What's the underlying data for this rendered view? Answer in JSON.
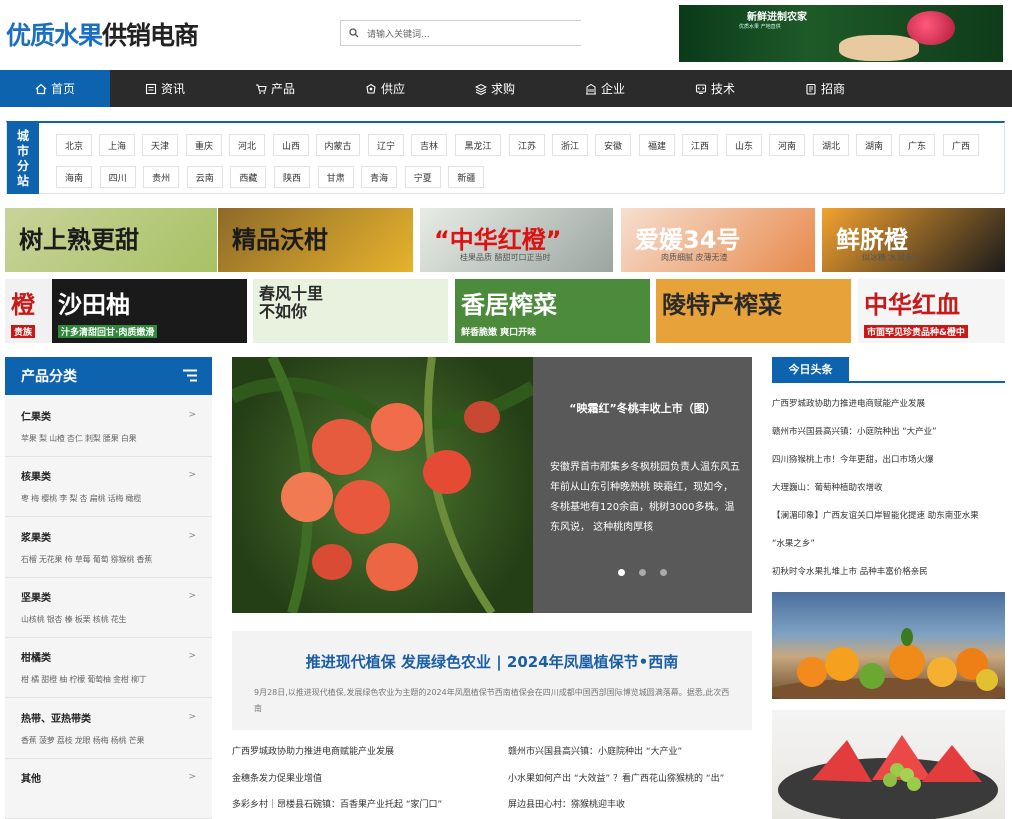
{
  "logo": {
    "part1": "优质水果",
    "part2": "供销电商"
  },
  "search": {
    "placeholder": "请输入关键词..."
  },
  "top_banner": {
    "title": "新鲜进制农家",
    "sub": "优质水果 产地直供"
  },
  "nav": {
    "items": [
      {
        "label": "首页",
        "icon": "home-icon"
      },
      {
        "label": "资讯",
        "icon": "news-icon"
      },
      {
        "label": "产品",
        "icon": "cart-icon"
      },
      {
        "label": "供应",
        "icon": "supply-icon"
      },
      {
        "label": "求购",
        "icon": "buy-icon"
      },
      {
        "label": "企业",
        "icon": "company-icon"
      },
      {
        "label": "技术",
        "icon": "tech-icon"
      },
      {
        "label": "招商",
        "icon": "invest-icon"
      }
    ]
  },
  "city": {
    "label": [
      "城",
      "市",
      "分",
      "站"
    ],
    "row1": [
      "北京",
      "上海",
      "天津",
      "重庆",
      "河北",
      "山西",
      "内蒙古",
      "辽宁",
      "吉林",
      "黑龙江",
      "江苏",
      "浙江",
      "安徽",
      "福建",
      "江西",
      "山东",
      "河南",
      "湖北",
      "湖南",
      "广东",
      "广西"
    ],
    "row2": [
      "海南",
      "四川",
      "贵州",
      "云南",
      "西藏",
      "陕西",
      "甘肃",
      "青海",
      "宁夏",
      "新疆"
    ]
  },
  "ads": {
    "row1": [
      "树上熟更甜",
      "精品沃柑",
      "“中华红橙”",
      "爱媛34号",
      "鲜脐橙"
    ],
    "row1_sub": [
      "",
      "",
      "桂果品质 醋甜可口正当时",
      "肉质细腻 皮薄无渣",
      "似冰糖 水润多汁"
    ],
    "row2": [
      "橙",
      "沙田柚",
      "春风十里\n不如你",
      "香居榨菜",
      "陵特产榨菜",
      "中华红血"
    ],
    "row2_sub": [
      "贵族",
      "汁多清甜回甘·肉质嫩滑",
      "",
      "鲜香脆嫩 爽口开味",
      "",
      "市面罕见珍贵品种&橙中"
    ]
  },
  "sidebar": {
    "title": "产品分类",
    "categories": [
      {
        "name": "仁果类",
        "items": "苹果 梨 山楂 杏仁 刺梨 腰果 白果"
      },
      {
        "name": "核果类",
        "items": "枣 梅 樱桃 李 梨 杏 扁桃 话梅 橄榄"
      },
      {
        "name": "浆果类",
        "items": "石榴 无花果 柿 草莓 葡萄 猕猴桃 香蕉"
      },
      {
        "name": "坚果类",
        "items": "山核桃 银杏 榛 板栗 核桃 花生"
      },
      {
        "name": "柑橘类",
        "items": "柑 橘 甜橙 柚 柠檬 葡萄柚 金柑 柳丁"
      },
      {
        "name": "热带、亚热带类",
        "items": "香蕉 菠萝 荔枝 龙眼 杨梅 杨桃 芒果"
      },
      {
        "name": "其他",
        "items": ""
      }
    ],
    "arrow": ">"
  },
  "slider": {
    "title": "“映霜红”冬桃丰收上市（图）",
    "desc": "安徽界首市邴集乡冬枫桃园负责人温东风五年前从山东引种晚熟桃 映霜红，现如今，冬桃基地有120余亩，桃树3000多株。温东风说， 这种桃肉厚核"
  },
  "feature": {
    "title": "推进现代植保 发展绿色农业 | 2024年凤凰植保节•西南",
    "desc": "9月28日,以推进现代植保,发展绿色农业为主题的2024年凤凰植保节西南植保会在四川成都中国西部国际博览城圆满落幕。据悉,此次西南"
  },
  "news": {
    "left": [
      "广西罗城政协助力推进电商赋能产业发展",
      "金穗条发力促果业增值",
      "多彩乡村｜昂楼县石碗镇：百香果产业托起 “家门口”"
    ],
    "right": [
      "赣州市兴国县高兴镇：小庭院种出 “大产业”",
      "小水果如何产出 “大效益” ？看广西花山猕猴桃的 “出”",
      "屏边县田心村：猕猴桃迎丰收"
    ]
  },
  "headlines": {
    "title": "今日头条",
    "items": [
      "广西罗城政协助力推进电商赋能产业发展",
      "赣州市兴国县高兴镇：小庭院种出 “大产业”",
      "四川猕猴桃上市！今年更甜，出口市场火爆",
      "大理巍山：葡萄种植助农增收",
      "【澜湄印象】广西友谊关口岸智能化提速 助东南亚水果",
      "“水果之乡”",
      "初秋时令水果扎堆上市 品种丰富价格亲民"
    ]
  }
}
